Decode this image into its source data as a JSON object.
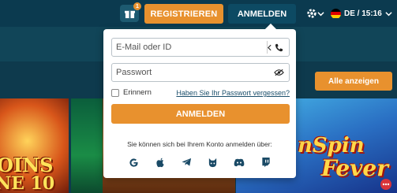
{
  "header": {
    "gift_badge": "1",
    "register_label": "REGISTRIEREN",
    "login_label": "ANMELDEN",
    "lang_label": "DE / 15:16"
  },
  "main": {
    "show_all_label": "Alle anzeigen"
  },
  "login_popup": {
    "email_placeholder": "E-Mail oder ID",
    "password_placeholder": "Passwort",
    "remember_label": "Erinnern",
    "forgot_label": "Haben Sie Ihr Passwort vergessen?",
    "submit_label": "ANMELDEN",
    "social_text": "Sie können sich bei Ihrem Konto anmelden über:",
    "social_icons": [
      "google-icon",
      "apple-icon",
      "telegram-icon",
      "steam-icon",
      "discord-icon",
      "twitch-icon"
    ]
  },
  "games": {
    "tile1_line1": "OINS",
    "tile1_line2": "NE 10",
    "tile4_line1": "nSpin",
    "tile4_line2": "Fever"
  },
  "colors": {
    "accent": "#e8912e",
    "header_bg": "#0b3a4f",
    "popup_bg": "#ffffff"
  }
}
